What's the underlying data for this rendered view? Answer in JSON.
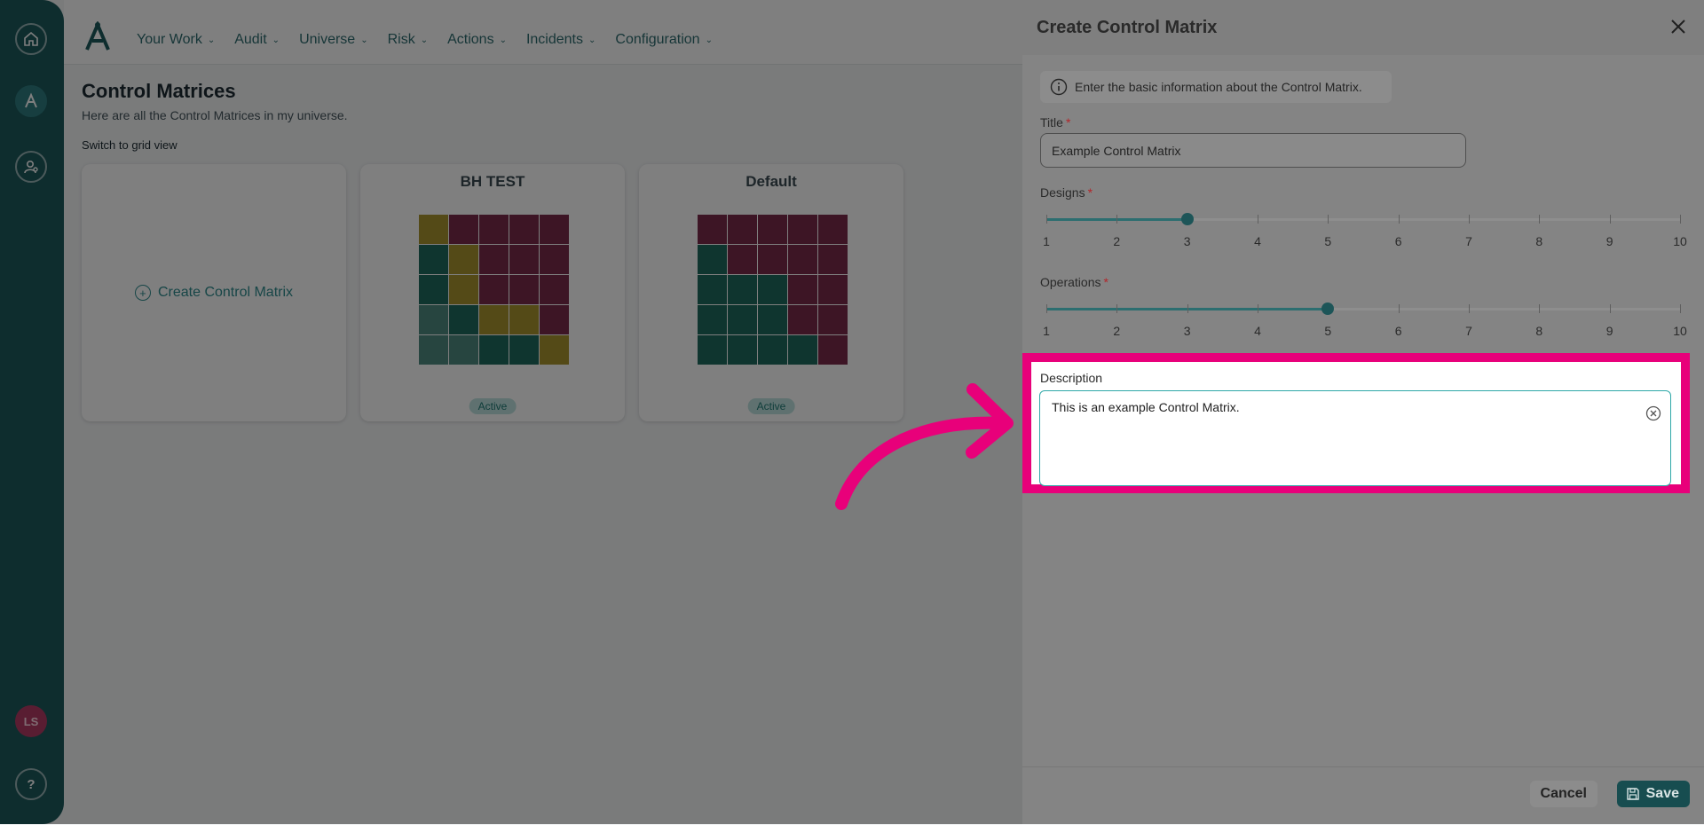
{
  "rail": {
    "avatar_initials": "LS",
    "help_symbol": "?"
  },
  "nav": {
    "items": [
      {
        "label": "Your Work"
      },
      {
        "label": "Audit"
      },
      {
        "label": "Universe"
      },
      {
        "label": "Risk"
      },
      {
        "label": "Actions"
      },
      {
        "label": "Incidents"
      },
      {
        "label": "Configuration"
      }
    ]
  },
  "page": {
    "title": "Control Matrices",
    "subtitle": "Here are all the Control Matrices in my universe.",
    "switch_link": "Switch to grid view"
  },
  "cards": {
    "create_label": "Create Control Matrix",
    "items": [
      {
        "title": "BH TEST",
        "status": "Active",
        "grid": [
          [
            "Y",
            "R",
            "R",
            "R",
            "R"
          ],
          [
            "G",
            "Y",
            "R",
            "R",
            "R"
          ],
          [
            "G",
            "Y",
            "R",
            "R",
            "R"
          ],
          [
            "L",
            "G",
            "Y",
            "Y",
            "R"
          ],
          [
            "L",
            "L",
            "G",
            "G",
            "Y"
          ]
        ]
      },
      {
        "title": "Default",
        "status": "Active",
        "grid": [
          [
            "R",
            "R",
            "R",
            "R",
            "R"
          ],
          [
            "G",
            "R",
            "R",
            "R",
            "R"
          ],
          [
            "G",
            "G",
            "G",
            "R",
            "R"
          ],
          [
            "G",
            "G",
            "G",
            "R",
            "R"
          ],
          [
            "G",
            "G",
            "G",
            "G",
            "R"
          ]
        ]
      }
    ]
  },
  "colors": {
    "R": "#7a2a4a",
    "Y": "#a8952e",
    "G": "#1f6b5e",
    "L": "#4e8a80",
    "accent_highlight": "#e8007a"
  },
  "drawer": {
    "title": "Create Control Matrix",
    "info_text": "Enter the basic information about the Control Matrix.",
    "title_label": "Title",
    "title_value": "Example Control Matrix",
    "required_mark": "*",
    "designs": {
      "label": "Designs",
      "value": 3,
      "min": 1,
      "max": 10,
      "ticks": [
        "1",
        "2",
        "3",
        "4",
        "5",
        "6",
        "7",
        "8",
        "9",
        "10"
      ]
    },
    "operations": {
      "label": "Operations",
      "value": 5,
      "min": 1,
      "max": 10,
      "ticks": [
        "1",
        "2",
        "3",
        "4",
        "5",
        "6",
        "7",
        "8",
        "9",
        "10"
      ]
    },
    "description_label": "Description",
    "description_value": "This is an example Control Matrix.",
    "cancel_label": "Cancel",
    "save_label": "Save"
  }
}
